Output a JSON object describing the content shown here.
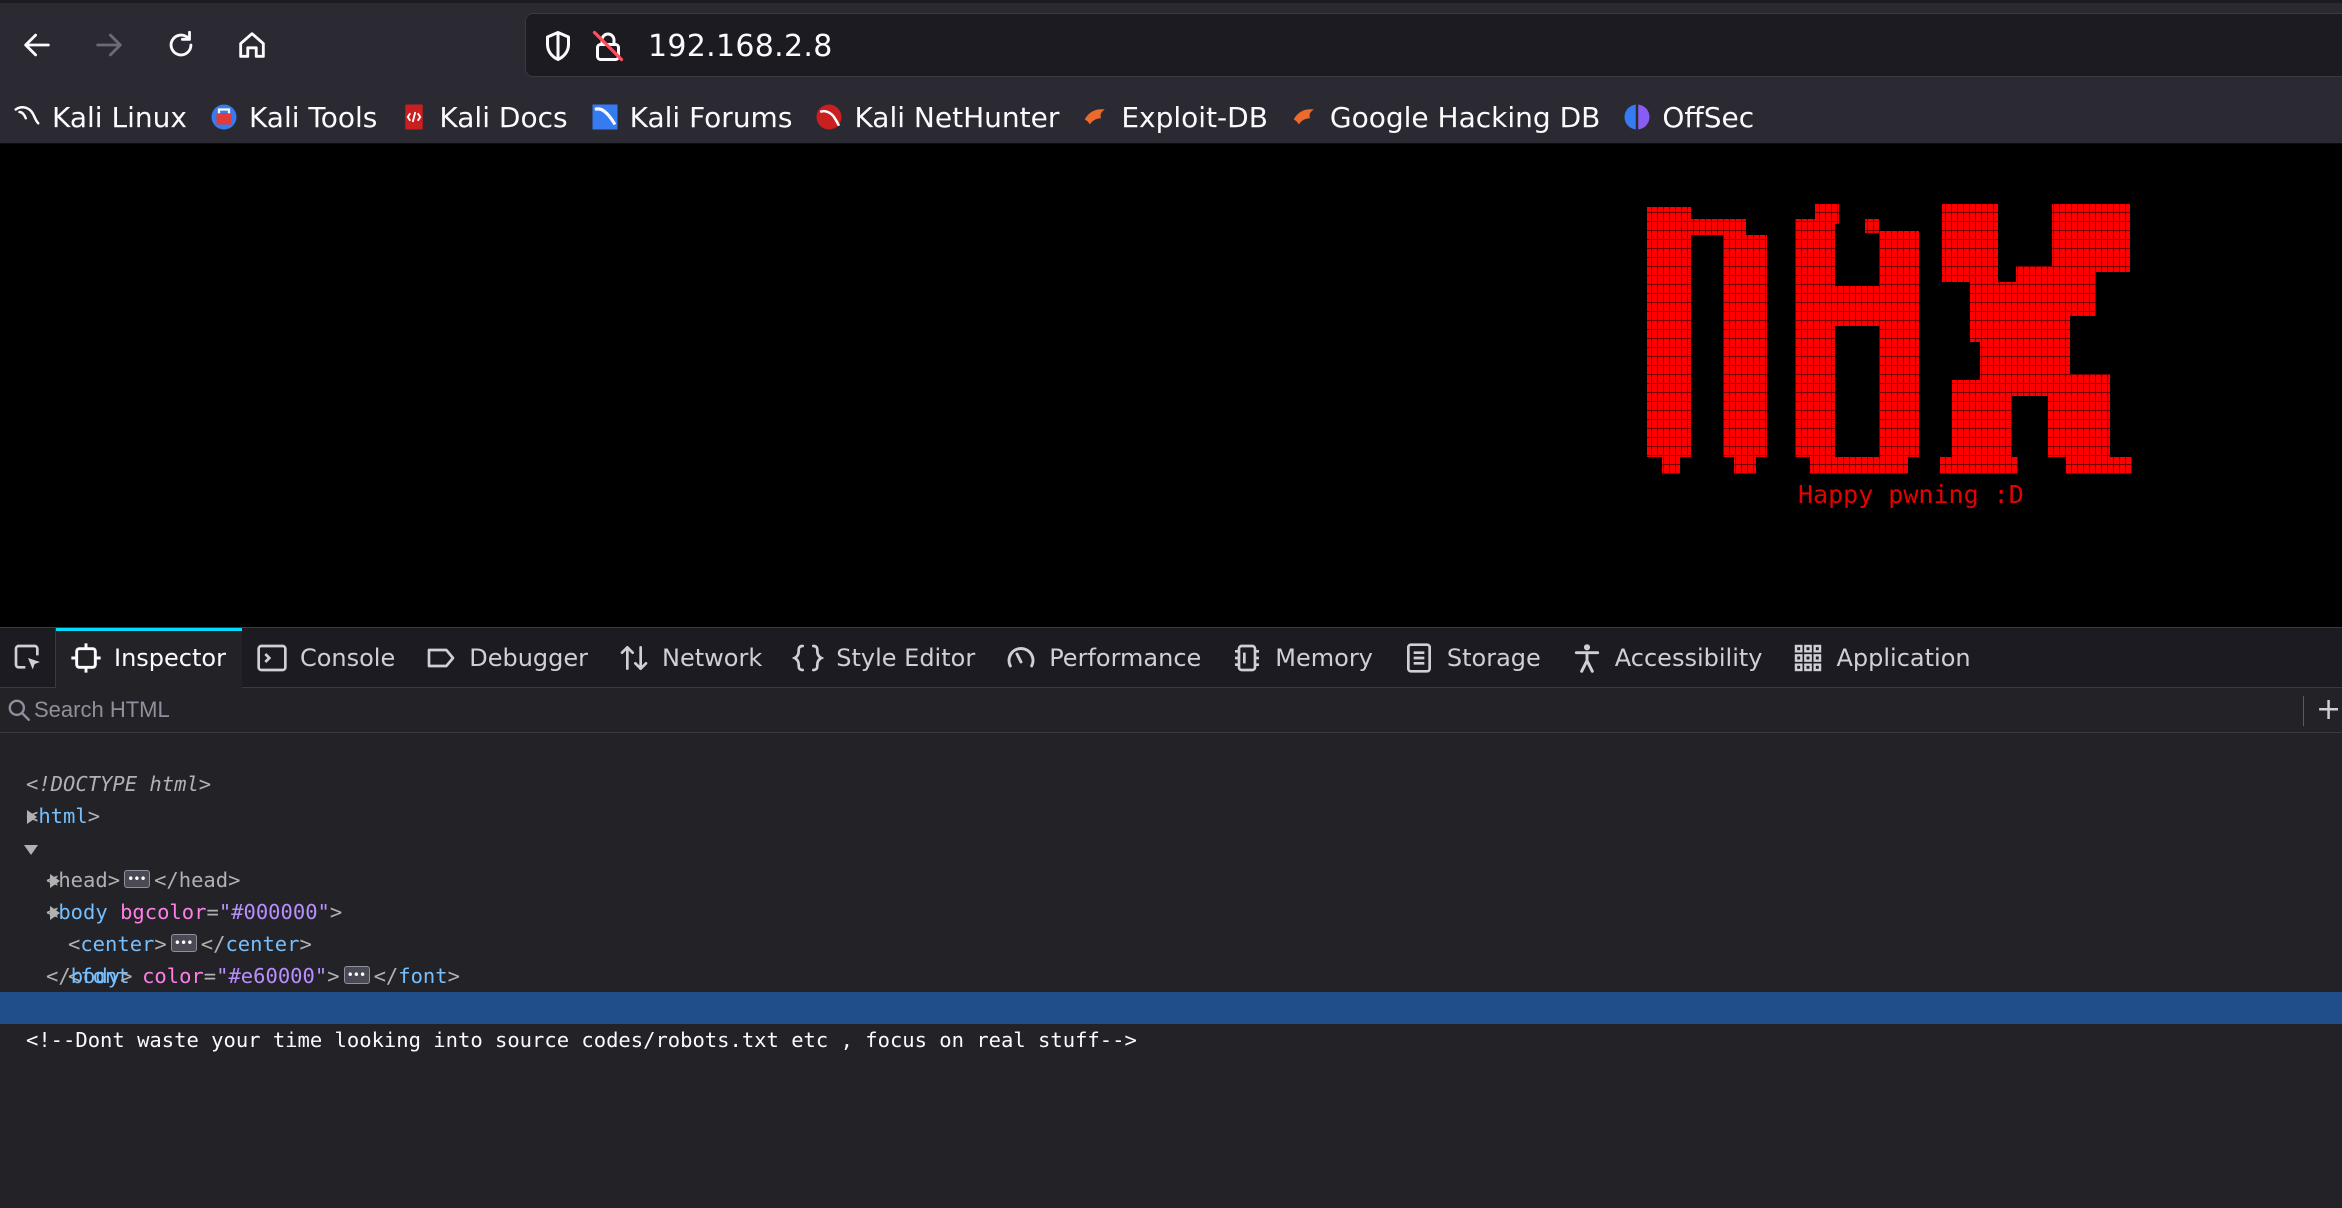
{
  "browser": {
    "url": "192.168.2.8",
    "bookmarks": [
      {
        "label": "Kali Linux",
        "icon": "kali-dragon-icon"
      },
      {
        "label": "Kali Tools",
        "icon": "kali-tools-icon"
      },
      {
        "label": "Kali Docs",
        "icon": "kali-docs-icon"
      },
      {
        "label": "Kali Forums",
        "icon": "kali-forums-icon"
      },
      {
        "label": "Kali NetHunter",
        "icon": "kali-nethunter-icon"
      },
      {
        "label": "Exploit-DB",
        "icon": "exploit-db-icon"
      },
      {
        "label": "Google Hacking DB",
        "icon": "ghdb-icon"
      },
      {
        "label": "OffSec",
        "icon": "offsec-icon"
      }
    ]
  },
  "page": {
    "background": "#000000",
    "text_color": "#e60000",
    "logo_text": "NHX",
    "tagline": "Happy pwning :D"
  },
  "devtools": {
    "tabs": [
      {
        "label": "Inspector",
        "icon": "inspector-icon",
        "active": true
      },
      {
        "label": "Console",
        "icon": "console-icon"
      },
      {
        "label": "Debugger",
        "icon": "debugger-icon"
      },
      {
        "label": "Network",
        "icon": "network-icon"
      },
      {
        "label": "Style Editor",
        "icon": "style-editor-icon"
      },
      {
        "label": "Performance",
        "icon": "performance-icon"
      },
      {
        "label": "Memory",
        "icon": "memory-icon"
      },
      {
        "label": "Storage",
        "icon": "storage-icon"
      },
      {
        "label": "Accessibility",
        "icon": "accessibility-icon"
      },
      {
        "label": "Application",
        "icon": "application-icon"
      }
    ],
    "search_placeholder": "Search HTML",
    "markup": {
      "doctype": "<!DOCTYPE html>",
      "html_open": "html",
      "head": "head",
      "body": "body",
      "body_attr": "bgcolor",
      "body_attr_value": "\"#000000\"",
      "center": "center",
      "font": "font",
      "font_attr": "color",
      "font_attr_value": "\"#e60000\"",
      "comment": "<!--Dont waste your time looking into source codes/robots.txt etc , focus on real stuff-->"
    }
  }
}
